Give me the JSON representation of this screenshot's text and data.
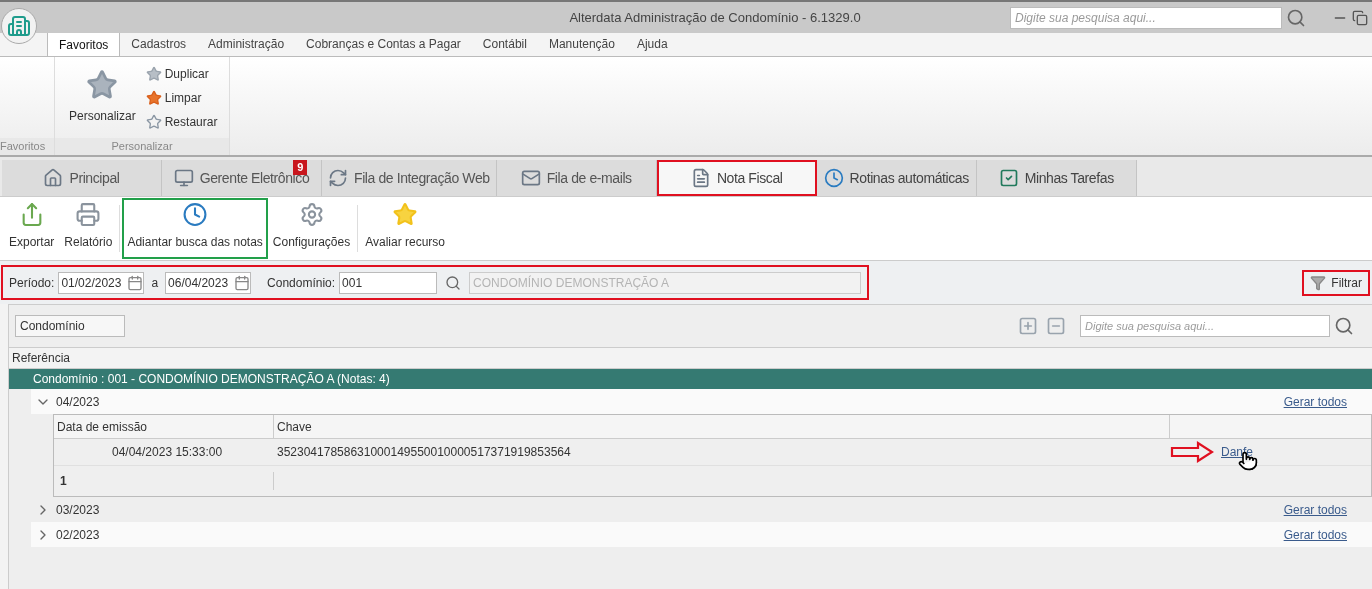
{
  "window": {
    "title": "Alterdata Administração de Condomínio - 6.1329.0",
    "search_placeholder": "Digite sua pesquisa aqui..."
  },
  "menu_tabs": [
    {
      "label": "Favoritos",
      "selected": true
    },
    {
      "label": "Cadastros",
      "selected": false
    },
    {
      "label": "Administração",
      "selected": false
    },
    {
      "label": "Cobranças e Contas a Pagar",
      "selected": false
    },
    {
      "label": "Contábil",
      "selected": false
    },
    {
      "label": "Manutenção",
      "selected": false
    },
    {
      "label": "Ajuda",
      "selected": false
    }
  ],
  "ribbon": {
    "large_button": "Personalizar",
    "small_buttons": [
      {
        "label": "Duplicar",
        "kind": "duplicate"
      },
      {
        "label": "Limpar",
        "kind": "clear"
      },
      {
        "label": "Restaurar",
        "kind": "restore"
      }
    ],
    "groups": [
      "Favoritos",
      "Personalizar"
    ]
  },
  "doc_tabs": [
    {
      "label": "Principal",
      "kind": "home",
      "selected": false
    },
    {
      "label": "Gerente Eletrônico",
      "kind": "monitor",
      "selected": false,
      "badge": "9"
    },
    {
      "label": "Fila de Integração Web",
      "kind": "sync",
      "selected": false
    },
    {
      "label": "Fila de e-mails",
      "kind": "mail",
      "selected": false
    },
    {
      "label": "Nota Fiscal",
      "kind": "doc",
      "selected": true,
      "color": "#e01020"
    },
    {
      "label": "Rotinas automáticas",
      "kind": "clock",
      "selected": false
    },
    {
      "label": "Minhas Tarefas",
      "kind": "check",
      "selected": false
    }
  ],
  "toolbar": [
    {
      "label": "Exportar",
      "kind": "export"
    },
    {
      "label": "Relatório",
      "kind": "print"
    },
    {
      "label": "Adiantar busca das notas",
      "kind": "clock",
      "color": "#22a04a"
    },
    {
      "label": "Configurações",
      "kind": "gear"
    },
    {
      "label": "Avaliar recurso",
      "kind": "star"
    }
  ],
  "filter": {
    "color": "#e01020",
    "period_label": "Período:",
    "date_from": "01/02/2023",
    "separator": "a",
    "date_to": "06/04/2023",
    "condo_label": "Condomínio:",
    "condo_code": "001",
    "condo_name": "CONDOMÍNIO DEMONSTRAÇÃO A",
    "filter_button": {
      "label": "Filtrar",
      "color": "#e01020"
    }
  },
  "grid": {
    "group_chip": "Condomínio",
    "search_placeholder": "Digite sua pesquisa aqui...",
    "column": "Referência",
    "group_row": "Condomínio : 001 - CONDOMÍNIO DEMONSTRAÇÃO A (Notas: 4)",
    "months": [
      {
        "label": "04/2023",
        "expanded": true,
        "action": "Gerar todos",
        "columns": [
          "Data de emissão",
          "Chave"
        ],
        "rows": [
          {
            "date": "04/04/2023 15:33:00",
            "key": "35230417858631000149550010000517371919853564",
            "link": "Danfe"
          }
        ],
        "count": "1"
      },
      {
        "label": "03/2023",
        "expanded": false,
        "action": "Gerar todos"
      },
      {
        "label": "02/2023",
        "expanded": false,
        "action": "Gerar todos"
      }
    ]
  }
}
